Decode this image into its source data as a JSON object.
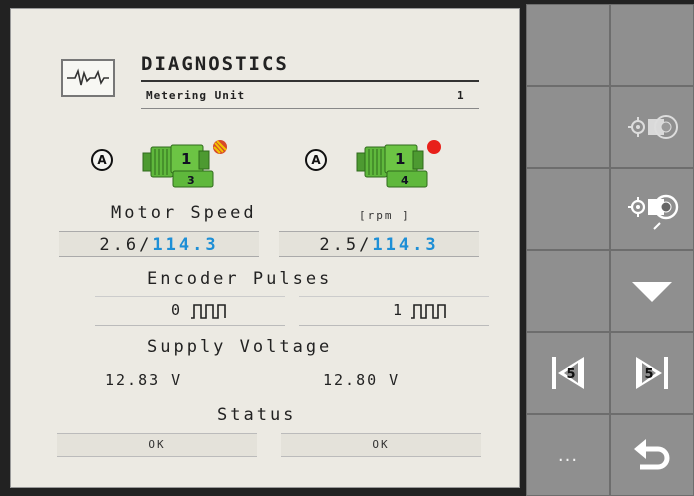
{
  "header": {
    "title": "DIAGNOSTICS",
    "subtitle": "Metering Unit",
    "unit_number": "1"
  },
  "motors": [
    {
      "mode": "A",
      "row_id": "1",
      "motor_id": "3",
      "indicator_color": "#d64a2a"
    },
    {
      "mode": "A",
      "row_id": "1",
      "motor_id": "4",
      "indicator_color": "#e8201a"
    }
  ],
  "motor_speed": {
    "label": "Motor Speed",
    "unit": "[rpm ]",
    "left": {
      "actual": "2.6",
      "sep": "/",
      "target": "114.3"
    },
    "right": {
      "actual": "2.5",
      "sep": "/",
      "target": "114.3"
    }
  },
  "encoder_pulses": {
    "label": "Encoder Pulses",
    "left": "0",
    "right": "1"
  },
  "supply_voltage": {
    "label": "Supply Voltage",
    "left": "12.83 V",
    "right": "12.80 V"
  },
  "status": {
    "label": "Status",
    "left": "OK",
    "right": "OK"
  },
  "softkeys": {
    "more_label": "...",
    "prev_page": "5",
    "next_page": "5"
  },
  "colors": {
    "accent_blue": "#1e8fd6",
    "motor_green": "#58b33a",
    "softkey_gray": "#8f8f8f",
    "panel_bg": "#eceae3"
  }
}
